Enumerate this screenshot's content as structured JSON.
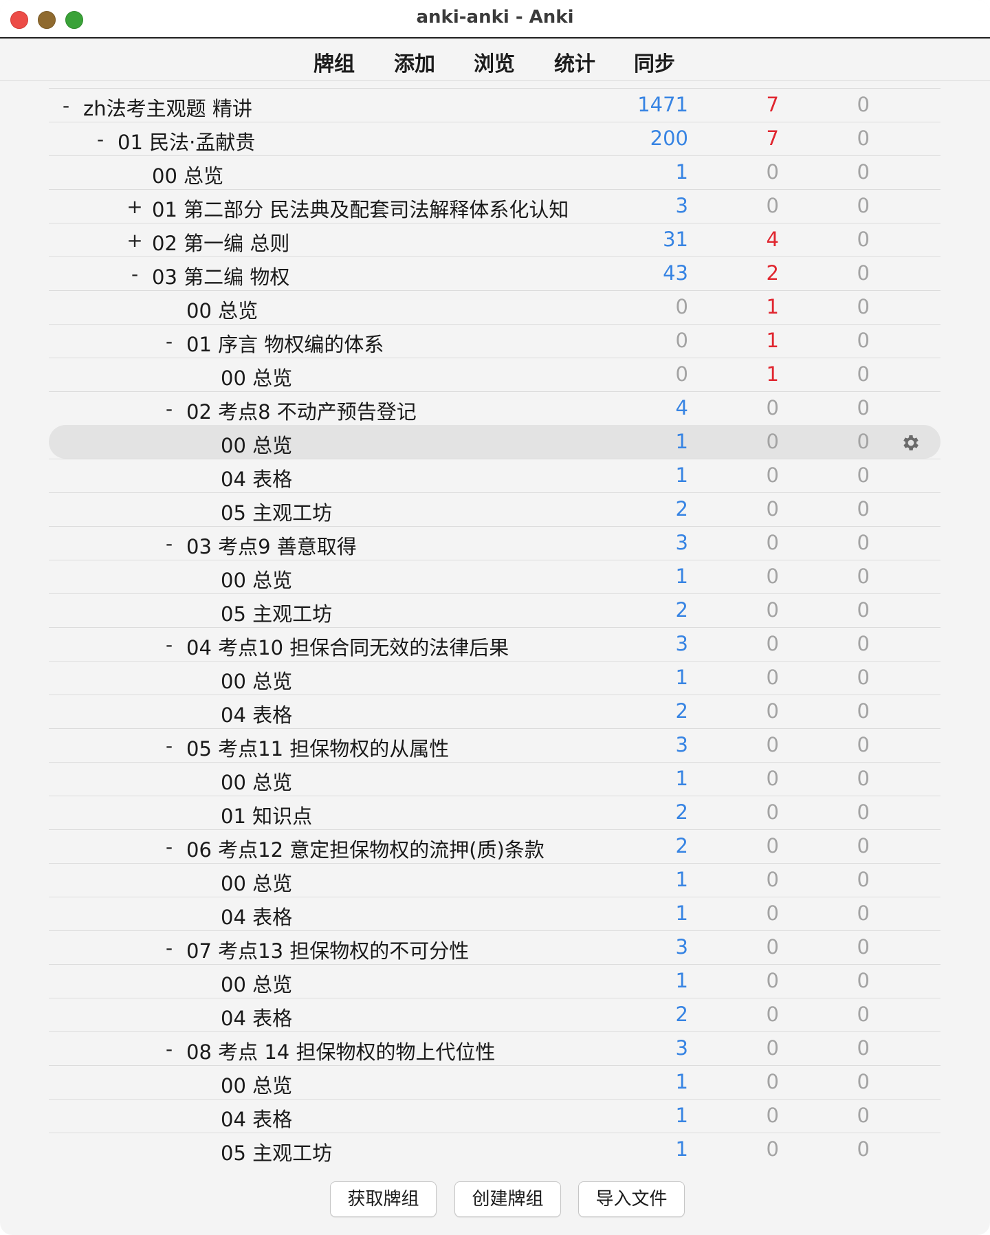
{
  "window": {
    "title": "anki-anki - Anki"
  },
  "toolbar": {
    "tabs": [
      "牌组",
      "添加",
      "浏览",
      "统计",
      "同步"
    ]
  },
  "decks": [
    {
      "toggle": "-",
      "name": "zh法考主观题 精讲",
      "new": "1471",
      "learn": "7",
      "review": "0",
      "level": 0
    },
    {
      "toggle": "-",
      "name": "01 民法·孟献贵",
      "new": "200",
      "learn": "7",
      "review": "0",
      "level": 1
    },
    {
      "toggle": "",
      "name": "00 总览",
      "new": "1",
      "learn": "0",
      "review": "0",
      "level": 2
    },
    {
      "toggle": "+",
      "name": "01 第二部分 民法典及配套司法解释体系化认知",
      "new": "3",
      "learn": "0",
      "review": "0",
      "level": 2
    },
    {
      "toggle": "+",
      "name": "02 第一编 总则",
      "new": "31",
      "learn": "4",
      "review": "0",
      "level": 2
    },
    {
      "toggle": "-",
      "name": "03 第二编 物权",
      "new": "43",
      "learn": "2",
      "review": "0",
      "level": 2
    },
    {
      "toggle": "",
      "name": "00 总览",
      "new": "0",
      "learn": "1",
      "review": "0",
      "level": 3
    },
    {
      "toggle": "-",
      "name": "01 序言 物权编的体系",
      "new": "0",
      "learn": "1",
      "review": "0",
      "level": 3
    },
    {
      "toggle": "",
      "name": "00 总览",
      "new": "0",
      "learn": "1",
      "review": "0",
      "level": 4
    },
    {
      "toggle": "-",
      "name": "02 考点8 不动产预告登记",
      "new": "4",
      "learn": "0",
      "review": "0",
      "level": 3
    },
    {
      "toggle": "",
      "name": "00 总览",
      "new": "1",
      "learn": "0",
      "review": "0",
      "level": 4,
      "selected": true
    },
    {
      "toggle": "",
      "name": "04 表格",
      "new": "1",
      "learn": "0",
      "review": "0",
      "level": 4
    },
    {
      "toggle": "",
      "name": "05 主观工坊",
      "new": "2",
      "learn": "0",
      "review": "0",
      "level": 4
    },
    {
      "toggle": "-",
      "name": "03 考点9 善意取得",
      "new": "3",
      "learn": "0",
      "review": "0",
      "level": 3
    },
    {
      "toggle": "",
      "name": "00 总览",
      "new": "1",
      "learn": "0",
      "review": "0",
      "level": 4
    },
    {
      "toggle": "",
      "name": "05 主观工坊",
      "new": "2",
      "learn": "0",
      "review": "0",
      "level": 4
    },
    {
      "toggle": "-",
      "name": "04 考点10 担保合同无效的法律后果",
      "new": "3",
      "learn": "0",
      "review": "0",
      "level": 3
    },
    {
      "toggle": "",
      "name": "00 总览",
      "new": "1",
      "learn": "0",
      "review": "0",
      "level": 4
    },
    {
      "toggle": "",
      "name": "04 表格",
      "new": "2",
      "learn": "0",
      "review": "0",
      "level": 4
    },
    {
      "toggle": "-",
      "name": "05 考点11 担保物权的从属性",
      "new": "3",
      "learn": "0",
      "review": "0",
      "level": 3
    },
    {
      "toggle": "",
      "name": "00 总览",
      "new": "1",
      "learn": "0",
      "review": "0",
      "level": 4
    },
    {
      "toggle": "",
      "name": "01 知识点",
      "new": "2",
      "learn": "0",
      "review": "0",
      "level": 4
    },
    {
      "toggle": "-",
      "name": "06 考点12 意定担保物权的流押(质)条款",
      "new": "2",
      "learn": "0",
      "review": "0",
      "level": 3
    },
    {
      "toggle": "",
      "name": "00 总览",
      "new": "1",
      "learn": "0",
      "review": "0",
      "level": 4
    },
    {
      "toggle": "",
      "name": "04 表格",
      "new": "1",
      "learn": "0",
      "review": "0",
      "level": 4
    },
    {
      "toggle": "-",
      "name": "07 考点13 担保物权的不可分性",
      "new": "3",
      "learn": "0",
      "review": "0",
      "level": 3
    },
    {
      "toggle": "",
      "name": "00 总览",
      "new": "1",
      "learn": "0",
      "review": "0",
      "level": 4
    },
    {
      "toggle": "",
      "name": "04 表格",
      "new": "2",
      "learn": "0",
      "review": "0",
      "level": 4
    },
    {
      "toggle": "-",
      "name": "08 考点 14 担保物权的物上代位性",
      "new": "3",
      "learn": "0",
      "review": "0",
      "level": 3
    },
    {
      "toggle": "",
      "name": "00 总览",
      "new": "1",
      "learn": "0",
      "review": "0",
      "level": 4
    },
    {
      "toggle": "",
      "name": "04 表格",
      "new": "1",
      "learn": "0",
      "review": "0",
      "level": 4
    },
    {
      "toggle": "",
      "name": "05 主观工坊",
      "new": "1",
      "learn": "0",
      "review": "0",
      "level": 4
    }
  ],
  "bottom_buttons": {
    "get_shared": "获取牌组",
    "create_deck": "创建牌组",
    "import_file": "导入文件"
  },
  "colors": {
    "new": "#3784e3",
    "learn": "#e0262f",
    "zero": "#a3a3a3"
  },
  "icons": {
    "options": "gear-icon"
  }
}
